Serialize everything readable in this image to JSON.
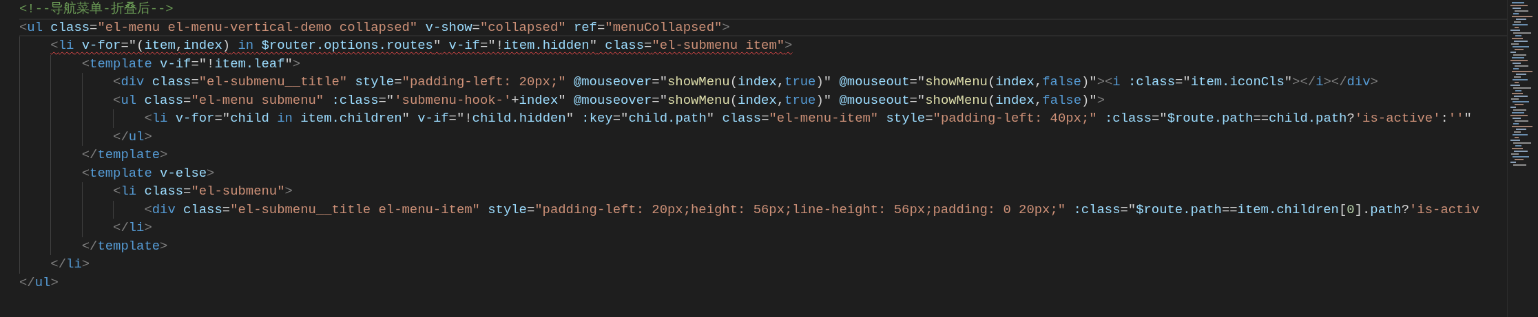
{
  "editor": {
    "lines": [
      {
        "current": false,
        "error": false,
        "tokens": [
          {
            "kind": "comment",
            "text": "<!--导航菜单-折叠后-->"
          }
        ]
      },
      {
        "current": true,
        "error": false,
        "tokens": [
          {
            "kind": "punct",
            "text": "<"
          },
          {
            "kind": "tag",
            "text": "ul"
          },
          {
            "kind": "attr",
            "text": " class"
          },
          {
            "kind": "plain",
            "text": "="
          },
          {
            "kind": "str",
            "text": "\"el-menu el-menu-vertical-demo collapsed\""
          },
          {
            "kind": "attr",
            "text": " v-show"
          },
          {
            "kind": "plain",
            "text": "="
          },
          {
            "kind": "str",
            "text": "\"collapsed\""
          },
          {
            "kind": "attr",
            "text": " ref"
          },
          {
            "kind": "plain",
            "text": "="
          },
          {
            "kind": "str",
            "text": "\"menuCollapsed\""
          },
          {
            "kind": "punct",
            "text": ">"
          }
        ]
      },
      {
        "current": false,
        "error": true,
        "tokens": [
          {
            "kind": "punct",
            "text": "    <"
          },
          {
            "kind": "tag",
            "text": "li"
          },
          {
            "kind": "attr",
            "text": " v-for"
          },
          {
            "kind": "plain",
            "text": "=\"("
          },
          {
            "kind": "var",
            "text": "item"
          },
          {
            "kind": "plain",
            "text": ","
          },
          {
            "kind": "var",
            "text": "index"
          },
          {
            "kind": "plain",
            "text": ")"
          },
          {
            "kind": "kw",
            "text": " in"
          },
          {
            "kind": "var",
            "text": " $router.options.routes"
          },
          {
            "kind": "plain",
            "text": "\""
          },
          {
            "kind": "attr",
            "text": " v-if"
          },
          {
            "kind": "plain",
            "text": "=\"!"
          },
          {
            "kind": "var",
            "text": "item.hidden"
          },
          {
            "kind": "plain",
            "text": "\""
          },
          {
            "kind": "attr",
            "text": " class"
          },
          {
            "kind": "plain",
            "text": "="
          },
          {
            "kind": "str",
            "text": "\"el-submenu item\""
          },
          {
            "kind": "punct",
            "text": ">"
          }
        ]
      },
      {
        "current": false,
        "error": false,
        "tokens": [
          {
            "kind": "punct",
            "text": "        <"
          },
          {
            "kind": "tag",
            "text": "template"
          },
          {
            "kind": "attr",
            "text": " v-if"
          },
          {
            "kind": "plain",
            "text": "=\"!"
          },
          {
            "kind": "var",
            "text": "item.leaf"
          },
          {
            "kind": "plain",
            "text": "\""
          },
          {
            "kind": "punct",
            "text": ">"
          }
        ]
      },
      {
        "current": false,
        "error": false,
        "tokens": [
          {
            "kind": "punct",
            "text": "            <"
          },
          {
            "kind": "tag",
            "text": "div"
          },
          {
            "kind": "attr",
            "text": " class"
          },
          {
            "kind": "plain",
            "text": "="
          },
          {
            "kind": "str",
            "text": "\"el-submenu__title\""
          },
          {
            "kind": "attr",
            "text": " style"
          },
          {
            "kind": "plain",
            "text": "="
          },
          {
            "kind": "str",
            "text": "\"padding-left: 20px;\""
          },
          {
            "kind": "attr",
            "text": " @mouseover"
          },
          {
            "kind": "plain",
            "text": "=\""
          },
          {
            "kind": "fn",
            "text": "showMenu"
          },
          {
            "kind": "plain",
            "text": "("
          },
          {
            "kind": "var",
            "text": "index"
          },
          {
            "kind": "plain",
            "text": ","
          },
          {
            "kind": "kw",
            "text": "true"
          },
          {
            "kind": "plain",
            "text": ")\""
          },
          {
            "kind": "attr",
            "text": " @mouseout"
          },
          {
            "kind": "plain",
            "text": "=\""
          },
          {
            "kind": "fn",
            "text": "showMenu"
          },
          {
            "kind": "plain",
            "text": "("
          },
          {
            "kind": "var",
            "text": "index"
          },
          {
            "kind": "plain",
            "text": ","
          },
          {
            "kind": "kw",
            "text": "false"
          },
          {
            "kind": "plain",
            "text": ")\""
          },
          {
            "kind": "punct",
            "text": "><"
          },
          {
            "kind": "tag",
            "text": "i"
          },
          {
            "kind": "attr",
            "text": " :class"
          },
          {
            "kind": "plain",
            "text": "=\""
          },
          {
            "kind": "var",
            "text": "item.iconCls"
          },
          {
            "kind": "plain",
            "text": "\""
          },
          {
            "kind": "punct",
            "text": "></"
          },
          {
            "kind": "tag",
            "text": "i"
          },
          {
            "kind": "punct",
            "text": "></"
          },
          {
            "kind": "tag",
            "text": "div"
          },
          {
            "kind": "punct",
            "text": ">"
          }
        ]
      },
      {
        "current": false,
        "error": false,
        "tokens": [
          {
            "kind": "punct",
            "text": "            <"
          },
          {
            "kind": "tag",
            "text": "ul"
          },
          {
            "kind": "attr",
            "text": " class"
          },
          {
            "kind": "plain",
            "text": "="
          },
          {
            "kind": "str",
            "text": "\"el-menu submenu\""
          },
          {
            "kind": "attr",
            "text": " :class"
          },
          {
            "kind": "plain",
            "text": "=\""
          },
          {
            "kind": "str",
            "text": "'submenu-hook-'"
          },
          {
            "kind": "plain",
            "text": "+"
          },
          {
            "kind": "var",
            "text": "index"
          },
          {
            "kind": "plain",
            "text": "\""
          },
          {
            "kind": "attr",
            "text": " @mouseover"
          },
          {
            "kind": "plain",
            "text": "=\""
          },
          {
            "kind": "fn",
            "text": "showMenu"
          },
          {
            "kind": "plain",
            "text": "("
          },
          {
            "kind": "var",
            "text": "index"
          },
          {
            "kind": "plain",
            "text": ","
          },
          {
            "kind": "kw",
            "text": "true"
          },
          {
            "kind": "plain",
            "text": ")\""
          },
          {
            "kind": "attr",
            "text": " @mouseout"
          },
          {
            "kind": "plain",
            "text": "=\""
          },
          {
            "kind": "fn",
            "text": "showMenu"
          },
          {
            "kind": "plain",
            "text": "("
          },
          {
            "kind": "var",
            "text": "index"
          },
          {
            "kind": "plain",
            "text": ","
          },
          {
            "kind": "kw",
            "text": "false"
          },
          {
            "kind": "plain",
            "text": ")\""
          },
          {
            "kind": "punct",
            "text": ">"
          }
        ]
      },
      {
        "current": false,
        "error": false,
        "tokens": [
          {
            "kind": "punct",
            "text": "                <"
          },
          {
            "kind": "tag",
            "text": "li"
          },
          {
            "kind": "attr",
            "text": " v-for"
          },
          {
            "kind": "plain",
            "text": "=\""
          },
          {
            "kind": "var",
            "text": "child"
          },
          {
            "kind": "kw",
            "text": " in"
          },
          {
            "kind": "var",
            "text": " item.children"
          },
          {
            "kind": "plain",
            "text": "\""
          },
          {
            "kind": "attr",
            "text": " v-if"
          },
          {
            "kind": "plain",
            "text": "=\"!"
          },
          {
            "kind": "var",
            "text": "child.hidden"
          },
          {
            "kind": "plain",
            "text": "\""
          },
          {
            "kind": "attr",
            "text": " :key"
          },
          {
            "kind": "plain",
            "text": "=\""
          },
          {
            "kind": "var",
            "text": "child.path"
          },
          {
            "kind": "plain",
            "text": "\""
          },
          {
            "kind": "attr",
            "text": " class"
          },
          {
            "kind": "plain",
            "text": "="
          },
          {
            "kind": "str",
            "text": "\"el-menu-item\""
          },
          {
            "kind": "attr",
            "text": " style"
          },
          {
            "kind": "plain",
            "text": "="
          },
          {
            "kind": "str",
            "text": "\"padding-left: 40px;\""
          },
          {
            "kind": "attr",
            "text": " :class"
          },
          {
            "kind": "plain",
            "text": "=\""
          },
          {
            "kind": "var",
            "text": "$route.path"
          },
          {
            "kind": "plain",
            "text": "=="
          },
          {
            "kind": "var",
            "text": "child.path"
          },
          {
            "kind": "plain",
            "text": "?"
          },
          {
            "kind": "str",
            "text": "'is-active'"
          },
          {
            "kind": "plain",
            "text": ":"
          },
          {
            "kind": "str",
            "text": "''"
          },
          {
            "kind": "plain",
            "text": "\""
          }
        ]
      },
      {
        "current": false,
        "error": false,
        "tokens": [
          {
            "kind": "punct",
            "text": "            </"
          },
          {
            "kind": "tag",
            "text": "ul"
          },
          {
            "kind": "punct",
            "text": ">"
          }
        ]
      },
      {
        "current": false,
        "error": false,
        "tokens": [
          {
            "kind": "punct",
            "text": "        </"
          },
          {
            "kind": "tag",
            "text": "template"
          },
          {
            "kind": "punct",
            "text": ">"
          }
        ]
      },
      {
        "current": false,
        "error": false,
        "tokens": [
          {
            "kind": "punct",
            "text": "        <"
          },
          {
            "kind": "tag",
            "text": "template"
          },
          {
            "kind": "attr",
            "text": " v-else"
          },
          {
            "kind": "punct",
            "text": ">"
          }
        ]
      },
      {
        "current": false,
        "error": false,
        "tokens": [
          {
            "kind": "punct",
            "text": "            <"
          },
          {
            "kind": "tag",
            "text": "li"
          },
          {
            "kind": "attr",
            "text": " class"
          },
          {
            "kind": "plain",
            "text": "="
          },
          {
            "kind": "str",
            "text": "\"el-submenu\""
          },
          {
            "kind": "punct",
            "text": ">"
          }
        ]
      },
      {
        "current": false,
        "error": false,
        "tokens": [
          {
            "kind": "punct",
            "text": "                <"
          },
          {
            "kind": "tag",
            "text": "div"
          },
          {
            "kind": "attr",
            "text": " class"
          },
          {
            "kind": "plain",
            "text": "="
          },
          {
            "kind": "str",
            "text": "\"el-submenu__title el-menu-item\""
          },
          {
            "kind": "attr",
            "text": " style"
          },
          {
            "kind": "plain",
            "text": "="
          },
          {
            "kind": "str",
            "text": "\"padding-left: 20px;height: 56px;line-height: 56px;padding: 0 20px;\""
          },
          {
            "kind": "attr",
            "text": " :class"
          },
          {
            "kind": "plain",
            "text": "=\""
          },
          {
            "kind": "var",
            "text": "$route.path"
          },
          {
            "kind": "plain",
            "text": "=="
          },
          {
            "kind": "var",
            "text": "item.children"
          },
          {
            "kind": "plain",
            "text": "["
          },
          {
            "kind": "num",
            "text": "0"
          },
          {
            "kind": "plain",
            "text": "]."
          },
          {
            "kind": "var",
            "text": "path"
          },
          {
            "kind": "plain",
            "text": "?"
          },
          {
            "kind": "str",
            "text": "'is-activ"
          }
        ]
      },
      {
        "current": false,
        "error": false,
        "tokens": [
          {
            "kind": "punct",
            "text": "            </"
          },
          {
            "kind": "tag",
            "text": "li"
          },
          {
            "kind": "punct",
            "text": ">"
          }
        ]
      },
      {
        "current": false,
        "error": false,
        "tokens": [
          {
            "kind": "punct",
            "text": "        </"
          },
          {
            "kind": "tag",
            "text": "template"
          },
          {
            "kind": "punct",
            "text": ">"
          }
        ]
      },
      {
        "current": false,
        "error": false,
        "tokens": [
          {
            "kind": "punct",
            "text": "    </"
          },
          {
            "kind": "tag",
            "text": "li"
          },
          {
            "kind": "punct",
            "text": ">"
          }
        ]
      },
      {
        "current": false,
        "error": false,
        "tokens": [
          {
            "kind": "punct",
            "text": "</"
          },
          {
            "kind": "tag",
            "text": "ul"
          },
          {
            "kind": "punct",
            "text": ">"
          }
        ]
      }
    ]
  }
}
